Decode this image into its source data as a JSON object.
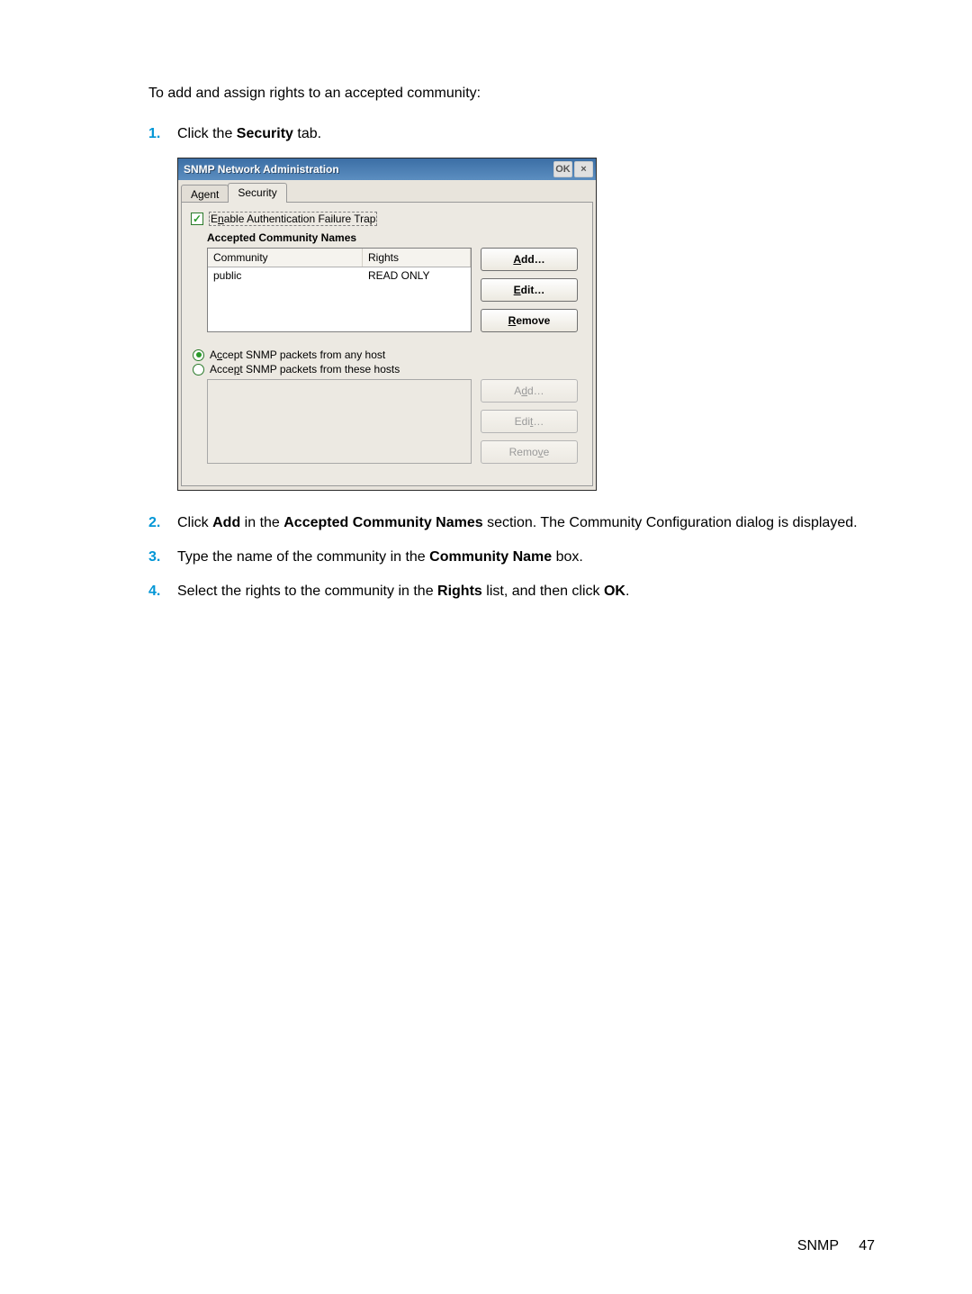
{
  "intro": "To add and assign rights to an accepted community:",
  "steps": [
    {
      "num": "1.",
      "pre": "Click the ",
      "bold": "Security",
      "post": " tab."
    },
    {
      "num": "2.",
      "parts": [
        "Click ",
        "Add",
        " in the ",
        "Accepted Community Names",
        " section. The Community Configuration dialog is displayed."
      ]
    },
    {
      "num": "3.",
      "parts": [
        "Type the name of the community in the ",
        "Community Name",
        " box."
      ]
    },
    {
      "num": "4.",
      "parts": [
        "Select the rights to the community in the ",
        "Rights",
        " list, and then click ",
        "OK",
        "."
      ]
    }
  ],
  "dialog": {
    "title": "SNMP Network Administration",
    "ok": "OK",
    "close": "×",
    "tabs": {
      "agent": "Agent",
      "security": "Security"
    },
    "enable_trap": "Enable Authentication Failure Trap",
    "section_head": "Accepted Community Names",
    "cols": {
      "community": "Community",
      "rights": "Rights"
    },
    "row": {
      "community": "public",
      "rights": "READ ONLY"
    },
    "btns": {
      "add": "Add…",
      "edit": "Edit…",
      "remove": "Remove",
      "add2": "Add…",
      "edit2": "Edit…",
      "remove2": "Remove"
    },
    "radios": {
      "any": "Accept SNMP packets from any host",
      "these": "Accept SNMP packets from these hosts"
    }
  },
  "footer": {
    "label": "SNMP",
    "page": "47"
  }
}
